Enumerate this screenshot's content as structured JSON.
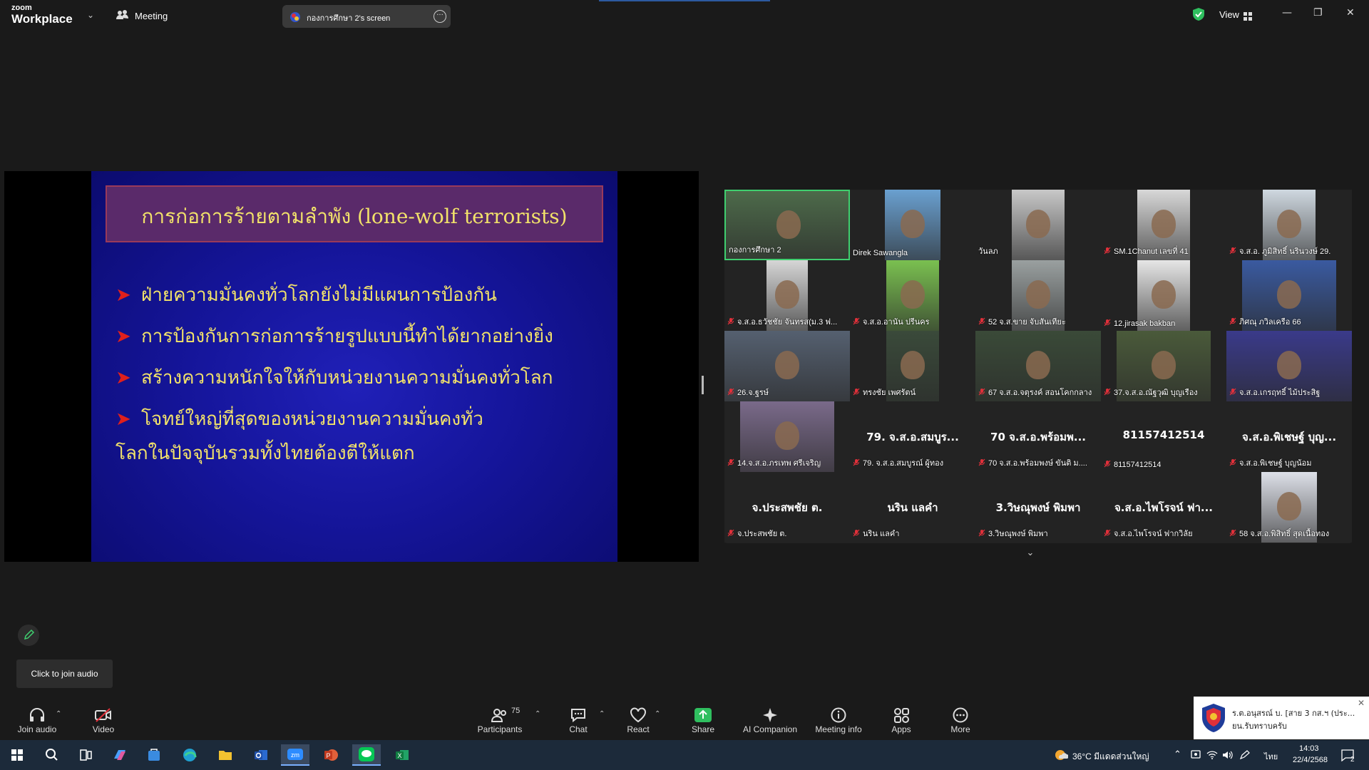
{
  "title_bar": {
    "brand_top": "zoom",
    "brand_bottom": "Workplace",
    "meeting_label": "Meeting",
    "screen_share_label": "กองการศึกษา 2's screen",
    "view_label": "View"
  },
  "slide": {
    "title": "การก่อการร้ายตามลำพัง (lone-wolf terrorists)",
    "bullets": [
      "ฝ่ายความมั่นคงทั่วโลกยังไม่มีแผนการป้องกัน",
      "การป้องกันการก่อการร้ายรูปแบบนี้ทำได้ยากอย่างยิ่ง",
      "สร้างความหนักใจให้กับหน่วยงานความมั่นคงทั่วโลก"
    ],
    "bullet4_line1": "โจทย์ใหญ่ที่สุดของหน่วยงานความมั่นคงทั่ว",
    "bullet4_line2": "โลกในปัจจุบันรวมทั้งไทยต้องตีให้แตก"
  },
  "gallery": {
    "tiles": [
      {
        "name": "กองการศึกษา 2",
        "muted": false,
        "center": ""
      },
      {
        "name": "Direk Sawangla",
        "muted": false,
        "center": ""
      },
      {
        "name": "วันลภ",
        "muted": false,
        "center": ""
      },
      {
        "name": "SM.1Chanut เลขที่ 41",
        "muted": true,
        "center": ""
      },
      {
        "name": "จ.ส.อ. ภูมิสิทธิ์ นรินวงษ์ 29.",
        "muted": true,
        "center": ""
      },
      {
        "name": "จ.ส.อ.ธวัชชัย จันทรส(ม.3 ฟ...",
        "muted": true,
        "center": ""
      },
      {
        "name": "จ.ส.อ.อานัน ปรีนคร",
        "muted": true,
        "center": ""
      },
      {
        "name": "52 จ.ส.ขาย  จับสันเทียะ",
        "muted": true,
        "center": ""
      },
      {
        "name": "12.jirasak bakban",
        "muted": true,
        "center": ""
      },
      {
        "name": "ภิศณุ ภวิลเครือ  66",
        "muted": true,
        "center": ""
      },
      {
        "name": "26.จ.ฐรษ์",
        "muted": true,
        "center": ""
      },
      {
        "name": "ทรงชัย  เพศรัตน์",
        "muted": true,
        "center": ""
      },
      {
        "name": "67 จ.ส.อ.จตุรงค์ สอนโคกกลาง",
        "muted": true,
        "center": ""
      },
      {
        "name": "37.จ.ส.อ.ณัฐวุฒิ  บุญเรือง",
        "muted": true,
        "center": ""
      },
      {
        "name": "จ.ส.อ.เกรฤทธิ์ ไม้ประสิฐ",
        "muted": true,
        "center": ""
      },
      {
        "name": "14.จ.ส.อ.ภรเทพ ศรีเจริญ",
        "muted": true,
        "center": ""
      },
      {
        "name": "79.  จ.ส.อ.สมบูรณ์  ผู้ทอง",
        "muted": true,
        "center": "79.  จ.ส.อ.สมบูร..."
      },
      {
        "name": "70 จ.ส.อ.พร้อมพงษ์ ขันติ ม....",
        "muted": true,
        "center": "70 จ.ส.อ.พร้อมพ..."
      },
      {
        "name": "81157412514",
        "muted": true,
        "center": "81157412514"
      },
      {
        "name": "จ.ส.อ.พิเชษฐ์ บุญน้อม",
        "muted": true,
        "center": "จ.ส.อ.พิเชษฐ์ บุญ..."
      },
      {
        "name": "จ.ประสพชัย ต.",
        "muted": true,
        "center": "จ.ประสพชัย ต."
      },
      {
        "name": "นริน แลคำ",
        "muted": true,
        "center": "นริน แลคำ"
      },
      {
        "name": "3.วิษณุพงษ์ พิมพา",
        "muted": true,
        "center": "3.วิษณุพงษ์ พิมพา"
      },
      {
        "name": "จ.ส.อ.ไพโรจน์ ฟากวิลัย",
        "muted": true,
        "center": "จ.ส.อ.ไพโรจน์ ฟา..."
      },
      {
        "name": "58 จ.ส.อ.พิสิทธิ์ สุดเนื้อทอง",
        "muted": true,
        "center": ""
      }
    ]
  },
  "tooltip": "Click to join audio",
  "toolbar": {
    "join_audio": "Join audio",
    "video": "Video",
    "participants": "Participants",
    "participants_count": "75",
    "chat": "Chat",
    "react": "React",
    "share": "Share",
    "ai_companion": "AI Companion",
    "meeting_info": "Meeting info",
    "apps": "Apps",
    "more": "More"
  },
  "notification": {
    "line1": "ร.ต.อนุสรณ์  บ. [สาย 3 กส.ฯ (ประ...",
    "line2": "ยน.รับทราบครับ"
  },
  "taskbar": {
    "weather": "36°C  มีแดดส่วนใหญ่",
    "lang": "ไทย",
    "time": "14:03",
    "date": "22/4/2568",
    "notif_count": "2"
  },
  "colors": {
    "accent_green": "#3fcf6f",
    "slide_text": "#f2e26a",
    "bullet_arrow": "#e0201c",
    "muted_red": "#e0303a"
  }
}
